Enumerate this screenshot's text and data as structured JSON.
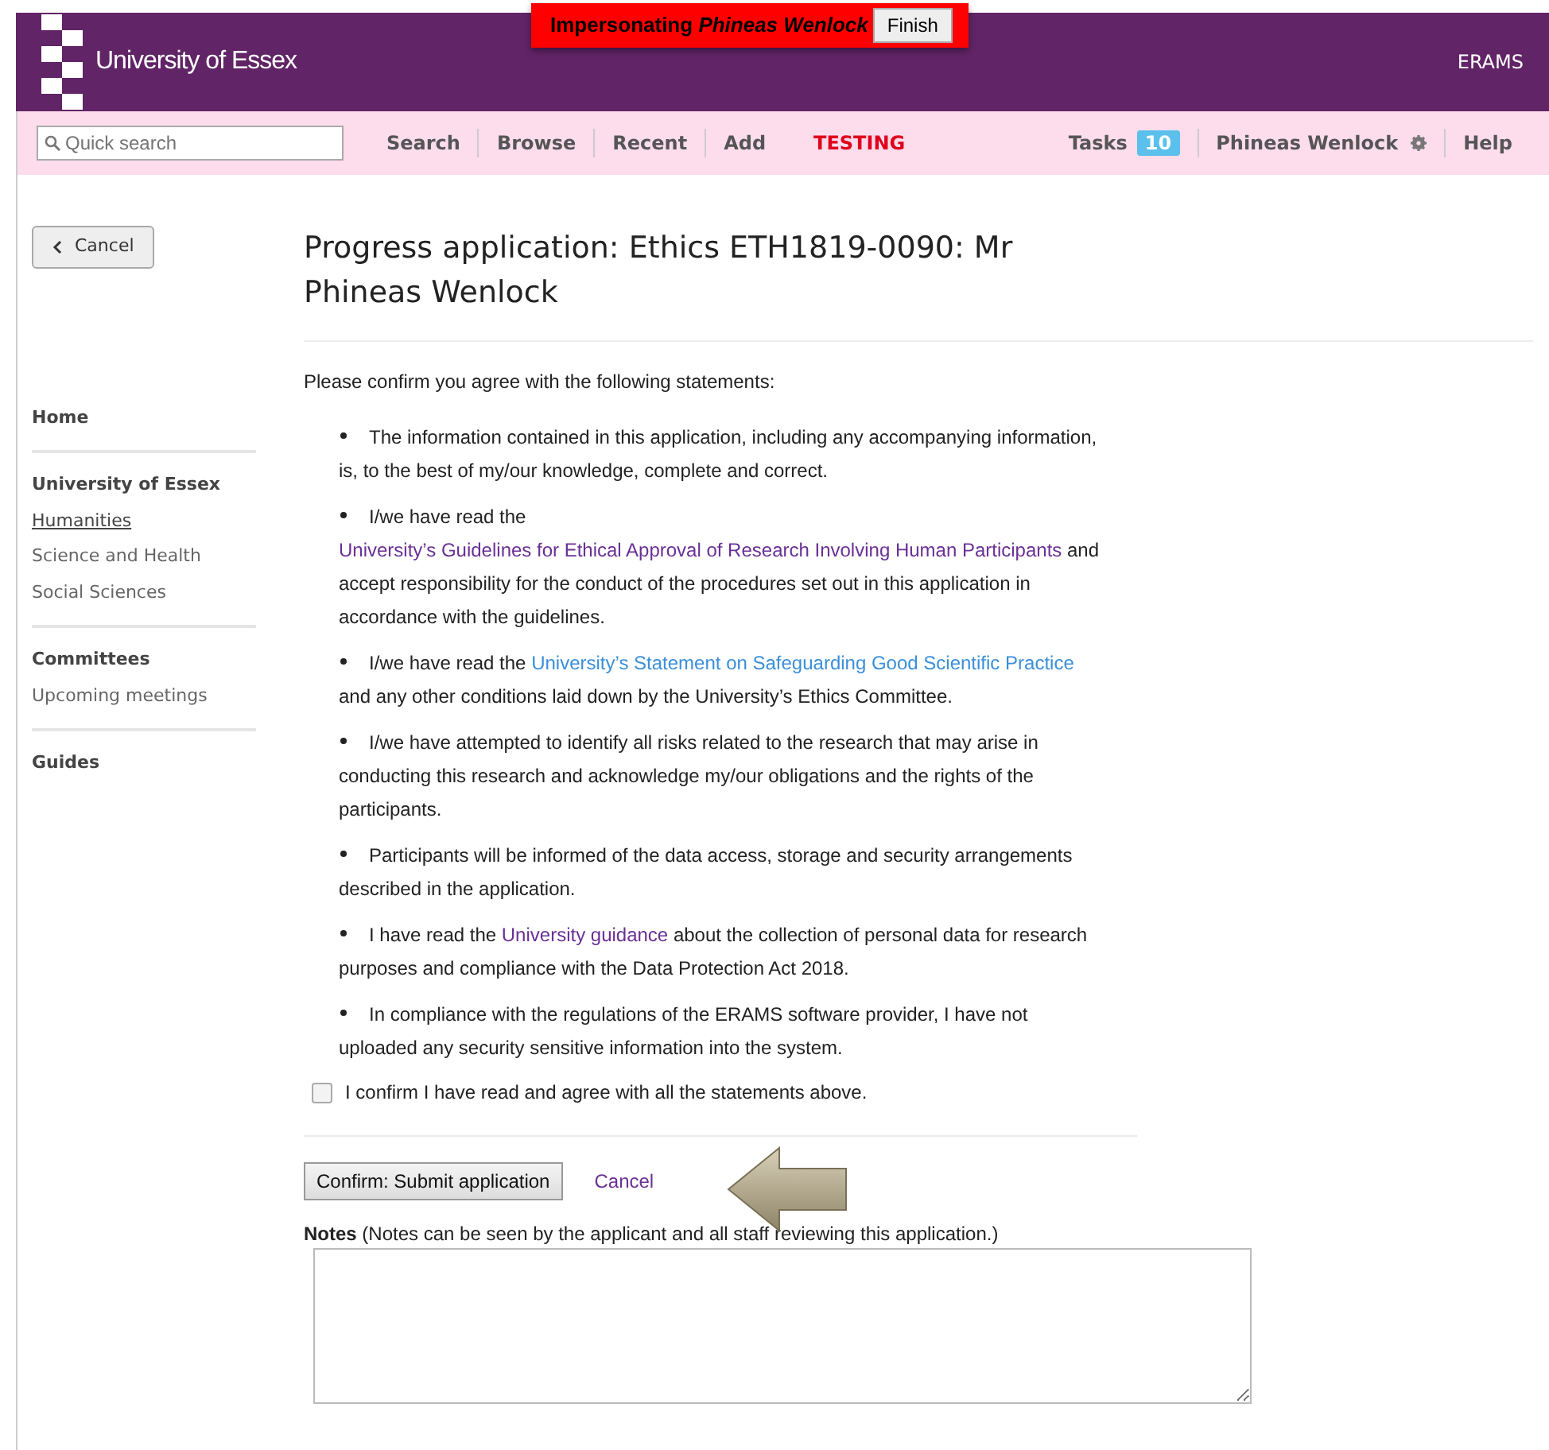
{
  "header": {
    "logo_text": "University of Essex",
    "impersonation": {
      "label": "Impersonating",
      "name": "Phineas Wenlock",
      "button": "Finish"
    },
    "app_name": "ERAMS"
  },
  "navbar": {
    "search": {
      "placeholder": "Quick search"
    },
    "links": [
      {
        "label": "Search",
        "kind": "link"
      },
      {
        "label": "Browse",
        "kind": "link"
      },
      {
        "label": "Recent",
        "kind": "link"
      },
      {
        "label": "Add",
        "kind": "link"
      },
      {
        "label": "TESTING",
        "kind": "alert"
      }
    ],
    "right": [
      {
        "label": "Tasks",
        "badge": "10",
        "kind": "tasks"
      },
      {
        "label": "Phineas Wenlock",
        "kind": "user"
      },
      {
        "label": "Help",
        "kind": "link"
      }
    ]
  },
  "back_button": "Cancel",
  "sidebar": [
    {
      "kind": "heading",
      "label": "Home"
    },
    {
      "kind": "divider"
    },
    {
      "kind": "heading",
      "label": "University of Essex"
    },
    {
      "kind": "link",
      "label": "Humanities",
      "selected": true
    },
    {
      "kind": "link",
      "label": "Science and Health",
      "selected": false
    },
    {
      "kind": "link",
      "label": "Social Sciences",
      "selected": false
    },
    {
      "kind": "divider"
    },
    {
      "kind": "heading",
      "label": "Committees"
    },
    {
      "kind": "link",
      "label": "Upcoming meetings",
      "selected": false
    },
    {
      "kind": "divider"
    },
    {
      "kind": "heading",
      "label": "Guides"
    }
  ],
  "page_title": "Progress application: Ethics ETH1819-0090: Mr Phineas Wenlock",
  "intro": "Please confirm you agree with the following statements:",
  "statements": [
    [
      {
        "kind": "text",
        "text": "The information contained in this application, including any accompanying information, is, to the best of my/our knowledge, complete and correct."
      }
    ],
    [
      {
        "kind": "text",
        "text": "I/we have read the "
      },
      {
        "kind": "link",
        "text": "University’s Guidelines for Ethical Approval of Research Involving Human Participants",
        "visited": true
      },
      {
        "kind": "text",
        "text": " and accept responsibility for the conduct of the procedures set out in this application in accordance with the guidelines."
      }
    ],
    [
      {
        "kind": "text",
        "text": "I/we have read the "
      },
      {
        "kind": "link",
        "text": "University’s Statement on Safeguarding Good Scientific Practice",
        "visited": false
      },
      {
        "kind": "text",
        "text": " and any other conditions laid down by the University’s Ethics Committee."
      }
    ],
    [
      {
        "kind": "text",
        "text": "I/we have attempted to identify all risks related to the research that may arise in conducting this research and acknowledge my/our obligations and the rights of the participants."
      }
    ],
    [
      {
        "kind": "text",
        "text": "Participants will be informed of the data access, storage and security arrangements described in the application."
      }
    ],
    [
      {
        "kind": "text",
        "text": "I have read the "
      },
      {
        "kind": "link",
        "text": "University guidance",
        "visited": true
      },
      {
        "kind": "text",
        "text": " about the collection of personal data for research purposes and compliance with the Data Protection Act 2018."
      }
    ],
    [
      {
        "kind": "text",
        "text": "In compliance with the regulations of the ERAMS software provider, I have not uploaded any security sensitive information into the system."
      }
    ]
  ],
  "confirm": {
    "label": "I confirm I have read and agree with all the statements above.",
    "checked": false
  },
  "submit_button": "Confirm:  Submit application",
  "cancel_link": "Cancel",
  "notes": {
    "label": "Notes",
    "hint": "(Notes can be seen by the applicant and all staff reviewing this application.)"
  }
}
